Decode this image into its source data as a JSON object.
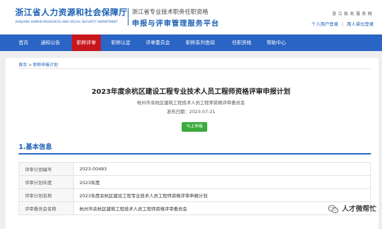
{
  "header": {
    "logo_cn": "浙江省人力资源和社会保障厅",
    "logo_en": "ZHEJIANG HUMAN RESOURCES AND SOCIAL SECURITY DEPARTMENT",
    "platform_sub": "浙江省专业技术职务任职资格",
    "platform_main": "申报与评审管理服务平台",
    "gov_text": "浙江政务服务网",
    "user_login": "个人用户登录",
    "org_login": "用人单位登录"
  },
  "nav": {
    "items": [
      {
        "label": "首页"
      },
      {
        "label": "通知公告"
      },
      {
        "label": "职称评审"
      },
      {
        "label": "职称认定"
      },
      {
        "label": "评审委员会"
      },
      {
        "label": "职称系列查阅"
      },
      {
        "label": "任职资格"
      },
      {
        "label": "帮助中心"
      }
    ],
    "active_index": 2
  },
  "breadcrumb": {
    "home": "首页",
    "separator": ">",
    "current": "职称申报计划"
  },
  "notice": {
    "title": "2023年度余杭区建设工程专业技术人员工程师资格评审申报计划",
    "org": "杭州市余杭区建筑工程技术人员工程师资格评审委员会",
    "date_label": "发布日期：",
    "date": "2023-07-21",
    "apply_button": "马上申报"
  },
  "section": {
    "title": "1.基本信息"
  },
  "info_rows": [
    {
      "label": "评审计划编号",
      "value": "2023-00483"
    },
    {
      "label": "评审计划年度",
      "value": "2023年度"
    },
    {
      "label": "评审计划名称",
      "value": "2023年度余杭区建设工程专业技术人员工程师资格评审申报计划"
    },
    {
      "label": "评审委员会名称",
      "value": "杭州市余杭区建筑工程技术人员工程师资格评审委员会"
    }
  ],
  "watermark": {
    "text": "人才微帮忙"
  },
  "colors": {
    "brand_blue": "#1b5fb4",
    "nav_blue": "#2a64c4",
    "active_red": "#c8161d",
    "button_green": "#3caa3c"
  }
}
